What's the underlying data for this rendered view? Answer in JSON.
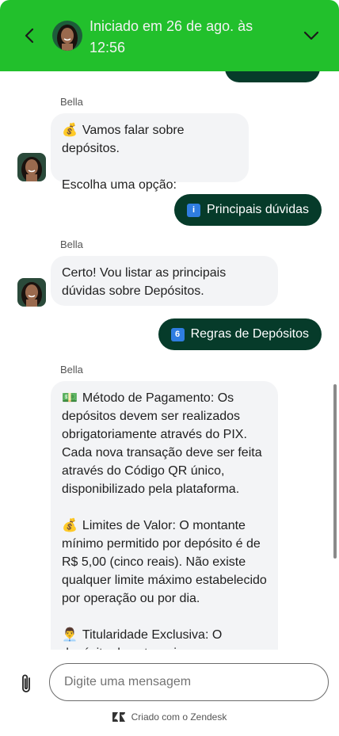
{
  "header": {
    "title": "Iniciado em 26 de ago. às 12:56",
    "bg": "#22c02c"
  },
  "messages": {
    "sender_name": "Bella",
    "bot1": {
      "line1": "Vamos falar sobre depósitos.",
      "line2": "Escolha uma opção:",
      "icon": "money-bag-icon"
    },
    "user1": {
      "label": "Principais dúvidas",
      "badge": "i"
    },
    "bot2": {
      "text": "Certo! Vou listar as principais dúvidas sobre Depósitos."
    },
    "user2": {
      "label": "Regras de Depósitos",
      "badge": "6"
    },
    "bot3": {
      "p1": "Método de Pagamento: Os depósitos devem ser realizados obrigatoriamente através do PIX. Cada nova transação deve ser feita através do Código QR único, disponibilizado pela plataforma.",
      "p2": "Limites de Valor: O montante mínimo permitido por depósito é de R$ 5,00 (cinco reais). Não existe qualquer limite máximo estabelecido por operação ou por dia.",
      "p3": "Titularidade Exclusiva: O depósito deve ter origem numa"
    }
  },
  "composer": {
    "placeholder": "Digite uma mensagem"
  },
  "footer": {
    "text": "Criado com o Zendesk"
  },
  "colors": {
    "accent_dark": "#063b2a",
    "bubble_bg": "#f3f4f6"
  }
}
